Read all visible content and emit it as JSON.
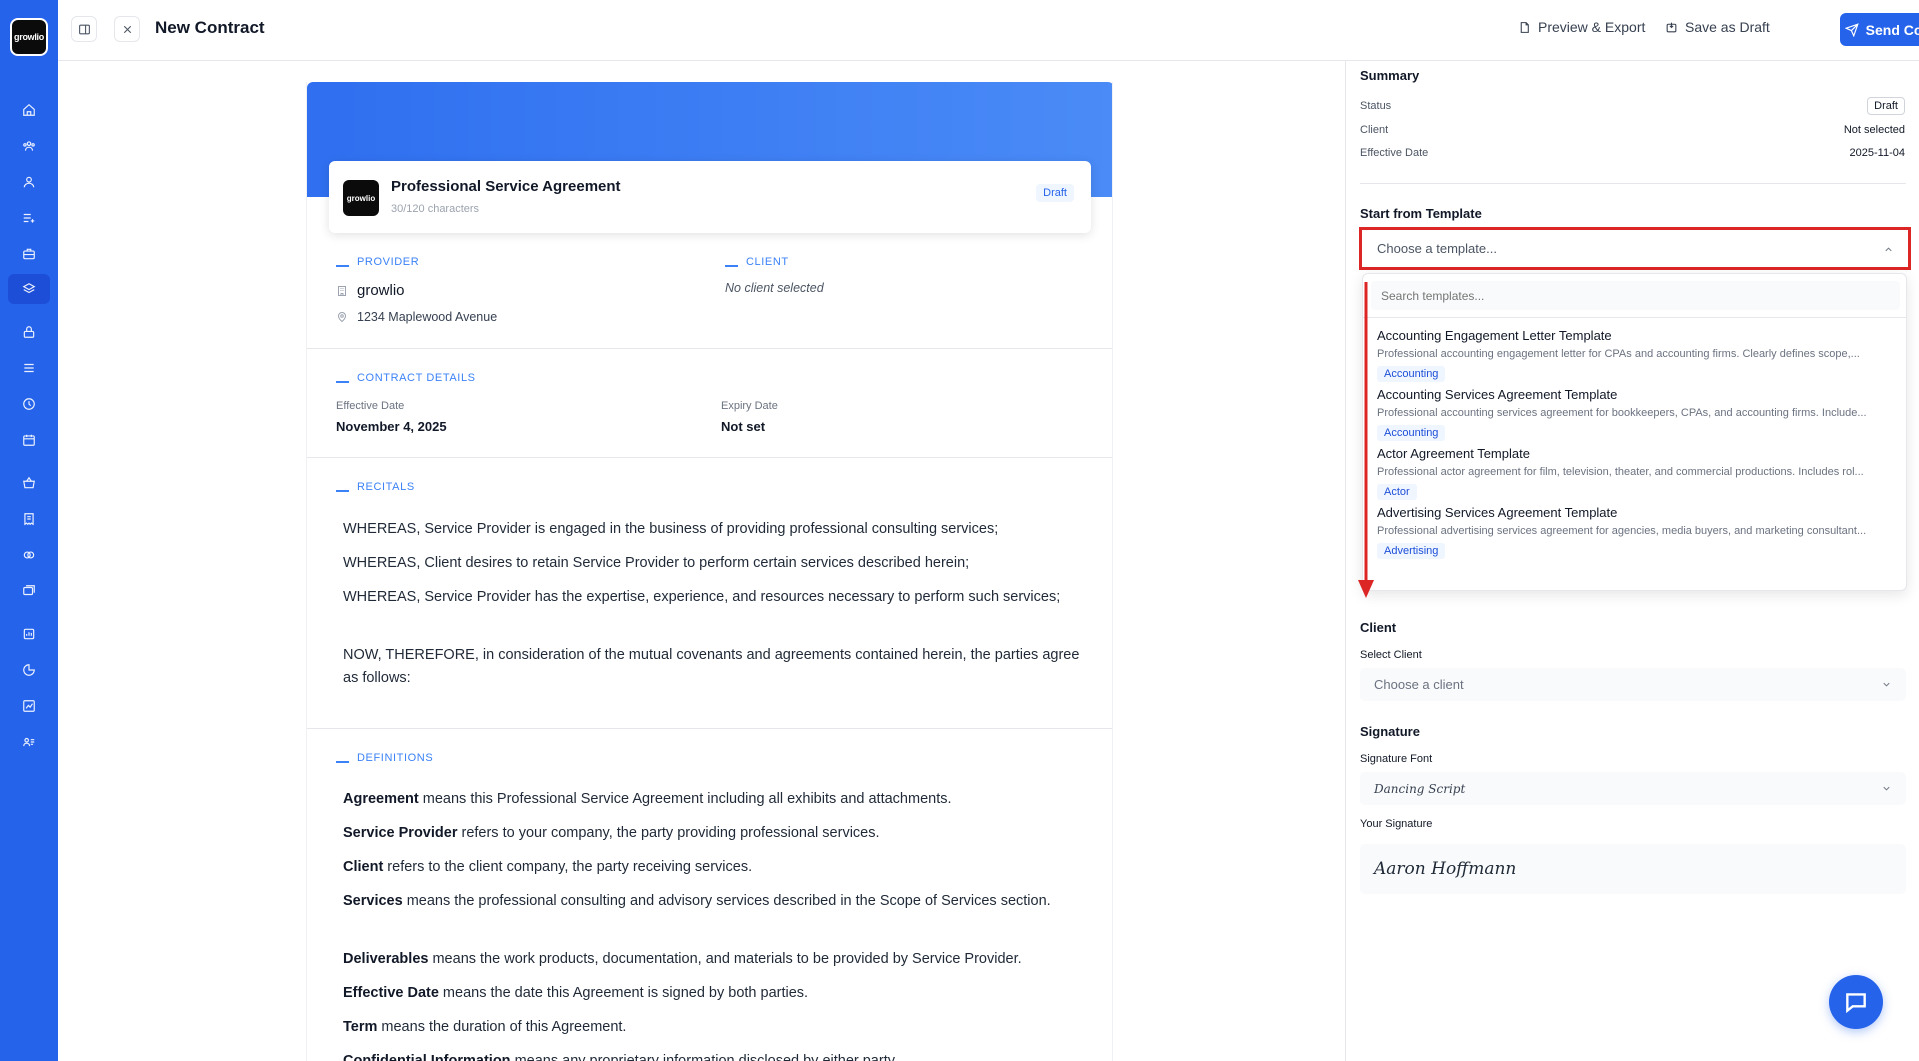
{
  "app": {
    "logo_text": "growlio"
  },
  "header": {
    "title": "New Contract",
    "preview_label": "Preview & Export",
    "save_label": "Save as Draft",
    "send_label": "Send Contract"
  },
  "sidebar": {
    "icons": [
      "home-icon",
      "team-icon",
      "user-icon",
      "list-add-icon",
      "briefcase-icon",
      "layers-icon",
      "lock-icon",
      "menu-icon",
      "clock-icon",
      "calendar-icon",
      "basket-icon",
      "receipt-icon",
      "coins-icon",
      "cards-icon",
      "report-icon",
      "pie-chart-icon",
      "chart-icon",
      "contacts-icon"
    ]
  },
  "document": {
    "title": "Professional Service Agreement",
    "char_count": "30/120 characters",
    "status": "Draft",
    "provider_label": "PROVIDER",
    "provider_name": "growlio",
    "provider_address": "1234 Maplewood Avenue",
    "client_label": "CLIENT",
    "client_value": "No client selected",
    "details_label": "CONTRACT DETAILS",
    "effective_label": "Effective Date",
    "effective_value": "November 4, 2025",
    "expiry_label": "Expiry Date",
    "expiry_value": "Not set",
    "recitals_label": "RECITALS",
    "recitals": [
      "WHEREAS, Service Provider is engaged in the business of providing professional consulting services;",
      "WHEREAS, Client desires to retain Service Provider to perform certain services described herein;",
      "WHEREAS, Service Provider has the expertise, experience, and resources necessary to perform such services;",
      "NOW, THEREFORE, in consideration of the mutual covenants and agreements contained herein, the parties agree as follows:"
    ],
    "definitions_label": "DEFINITIONS",
    "definitions": [
      {
        "term": "Agreement",
        "text": " means this Professional Service Agreement including all exhibits and attachments."
      },
      {
        "term": "Service Provider",
        "text": " refers to your company, the party providing professional services."
      },
      {
        "term": "Client",
        "text": " refers to the client company, the party receiving services."
      },
      {
        "term": "Services",
        "text": " means the professional consulting and advisory services described in the Scope of Services section."
      },
      {
        "term": "Deliverables",
        "text": " means the work products, documentation, and materials to be provided by Service Provider."
      },
      {
        "term": "Effective Date",
        "text": " means the date this Agreement is signed by both parties."
      },
      {
        "term": "Term",
        "text": " means the duration of this Agreement."
      },
      {
        "term": "Confidential Information",
        "text": " means any proprietary information disclosed by either party."
      }
    ]
  },
  "summary": {
    "heading": "Summary",
    "status_label": "Status",
    "status_value": "Draft",
    "client_label": "Client",
    "client_value": "Not selected",
    "effective_label": "Effective Date",
    "effective_value": "2025-11-04"
  },
  "template": {
    "heading": "Start from Template",
    "placeholder": "Choose a template...",
    "search_placeholder": "Search templates...",
    "items": [
      {
        "title": "Accounting Engagement Letter Template",
        "desc": "Professional accounting engagement letter for CPAs and accounting firms. Clearly defines scope,...",
        "tag": "Accounting"
      },
      {
        "title": "Accounting Services Agreement Template",
        "desc": "Professional accounting services agreement for bookkeepers, CPAs, and accounting firms. Include...",
        "tag": "Accounting"
      },
      {
        "title": "Actor Agreement Template",
        "desc": "Professional actor agreement for film, television, theater, and commercial productions. Includes rol...",
        "tag": "Actor"
      },
      {
        "title": "Advertising Services Agreement Template",
        "desc": "Professional advertising services agreement for agencies, media buyers, and marketing consultant...",
        "tag": "Advertising"
      }
    ]
  },
  "client_section": {
    "heading": "Client",
    "select_label": "Select Client",
    "placeholder": "Choose a client"
  },
  "signature": {
    "heading": "Signature",
    "font_label": "Signature Font",
    "font_value": "Dancing Script",
    "your_label": "Your Signature",
    "signature_text": "Aaron Hoffmann"
  },
  "colors": {
    "accent": "#2563eb",
    "highlight": "#dc2626"
  }
}
